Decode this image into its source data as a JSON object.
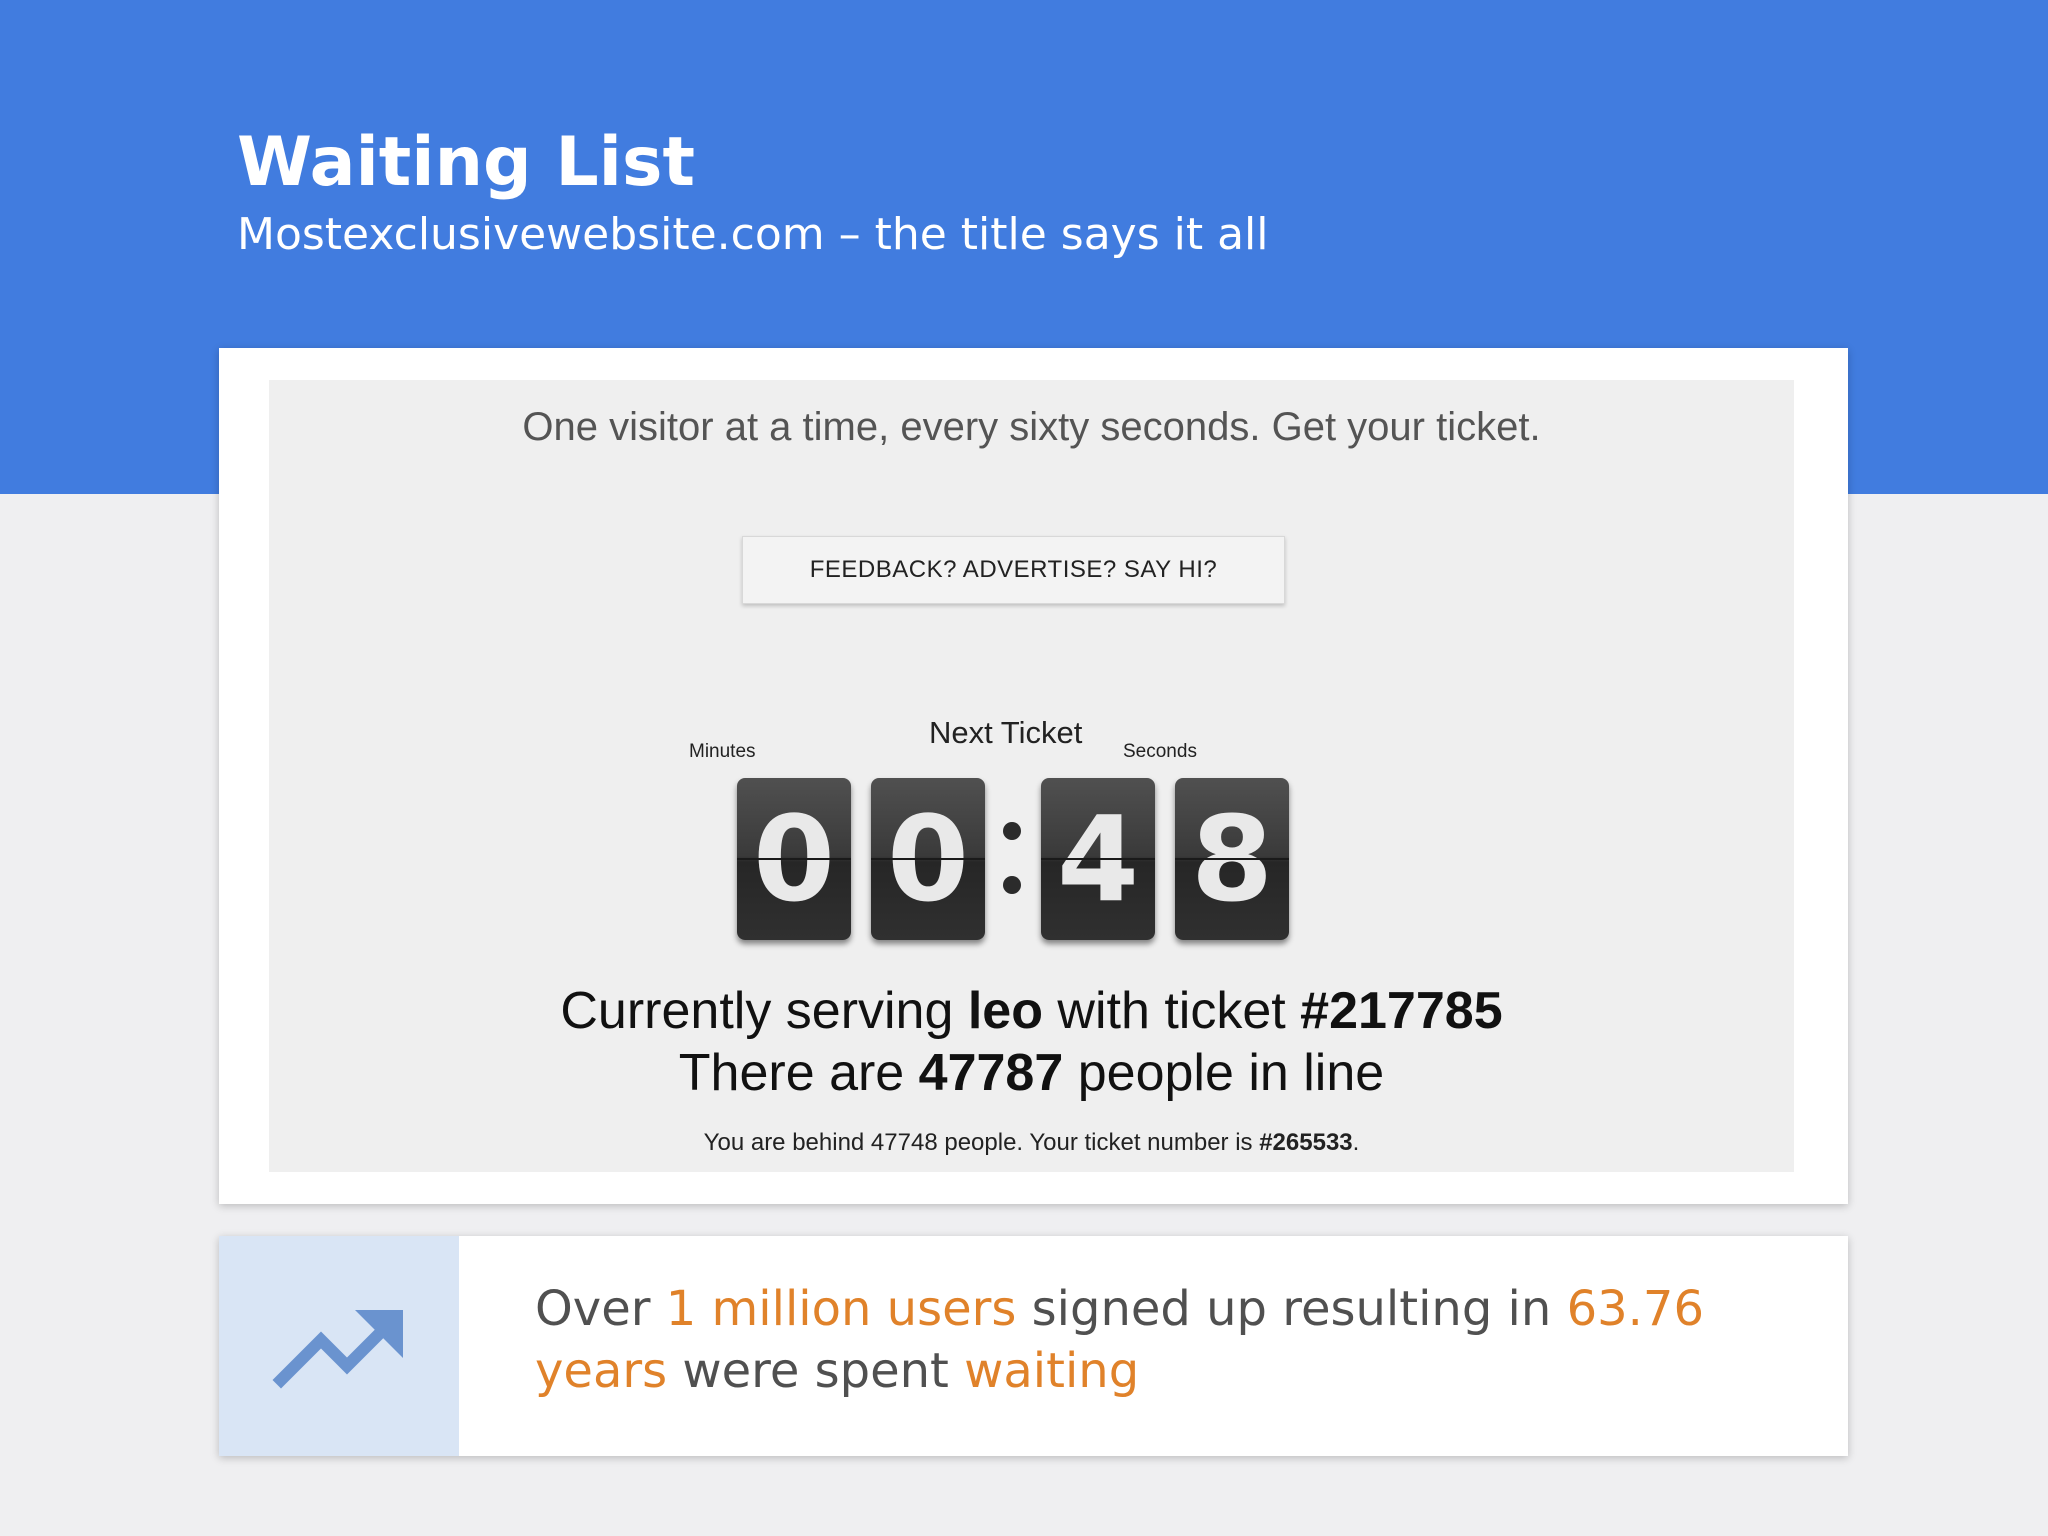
{
  "slide": {
    "title": "Waiting List",
    "subtitle": "Mostexclusivewebsite.com – the title says it all",
    "header_color": "#417cdf"
  },
  "screenshot": {
    "tagline": "One visitor at a time, every sixty seconds. Get your ticket.",
    "feedback_button": "FEEDBACK? ADVERTISE? SAY HI?",
    "timer": {
      "label_minutes": "Minutes",
      "label_next": "Next Ticket",
      "label_seconds": "Seconds",
      "digits": [
        "0",
        "0",
        "4",
        "8"
      ],
      "separator": ":"
    },
    "serving": {
      "prefix": "Currently serving ",
      "name": "leo",
      "middle": " with ticket ",
      "ticket": "#217785"
    },
    "line": {
      "prefix": "There are ",
      "count": "47787",
      "suffix": " people in line"
    },
    "behind": {
      "prefix": "You are behind 47748 people. Your ticket number is ",
      "ticket": "#265533",
      "suffix": "."
    }
  },
  "stat": {
    "icon": "trending-up-icon",
    "accent_color": "#e0822a",
    "part1": "Over ",
    "part2": "1 million users",
    "part3": " signed up resulting in ",
    "part4": "63.76 years",
    "part5": " were spent ",
    "part6": "waiting"
  }
}
